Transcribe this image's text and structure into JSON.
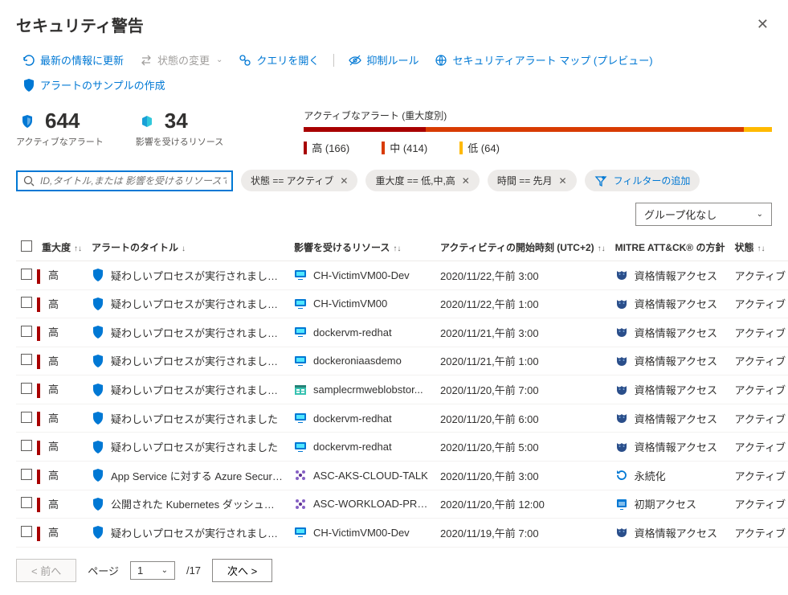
{
  "title": "セキュリティ警告",
  "toolbar": {
    "refresh": "最新の情報に更新",
    "change_state": "状態の変更",
    "open_query": "クエリを開く",
    "suppression": "抑制ルール",
    "alert_map": "セキュリティアラート マップ (プレビュー)",
    "create_sample": "アラートのサンプルの作成"
  },
  "stats": {
    "active_count": "644",
    "active_label": "アクティブなアラート",
    "resources_count": "34",
    "resources_label": "影響を受けるリソース"
  },
  "severity": {
    "title": "アクティブなアラート (重大度別)",
    "high": "高 (166)",
    "medium": "中 (414)",
    "low": "低 (64)"
  },
  "search_placeholder": "ID,タイトル,または 影響を受けるリソースで検索",
  "filters": {
    "state": "状態 == アクティブ",
    "severity": "重大度 == 低,中,高",
    "time": "時間 == 先月",
    "add": "フィルターの追加"
  },
  "group_by": "グループ化なし",
  "columns": {
    "severity": "重大度",
    "title": "アラートのタイトル",
    "resource": "影響を受けるリソース",
    "time": "アクティビティの開始時刻 (UTC+2)",
    "mitre": "MITRE ATT&CK® の方針",
    "state": "状態"
  },
  "rows": [
    {
      "sev": "高",
      "title": "疑わしいプロセスが実行されました [複数 ...",
      "res": "CH-VictimVM00-Dev",
      "res_ico": "vm",
      "time": "2020/11/22,午前 3:00",
      "mitre": "資格情報アクセス",
      "mitre_ico": "mask",
      "state": "アクティブ"
    },
    {
      "sev": "高",
      "title": "疑わしいプロセスが実行されました [複数 ...",
      "res": "CH-VictimVM00",
      "res_ico": "vm",
      "time": "2020/11/22,午前 1:00",
      "mitre": "資格情報アクセス",
      "mitre_ico": "mask",
      "state": "アクティブ"
    },
    {
      "sev": "高",
      "title": "疑わしいプロセスが実行されました [複数 ...",
      "res": "dockervm-redhat",
      "res_ico": "vm",
      "time": "2020/11/21,午前 3:00",
      "mitre": "資格情報アクセス",
      "mitre_ico": "mask",
      "state": "アクティブ"
    },
    {
      "sev": "高",
      "title": "疑わしいプロセスが実行されました [複数 ...",
      "res": "dockeroniaasdemo",
      "res_ico": "vm",
      "time": "2020/11/21,午前 1:00",
      "mitre": "資格情報アクセス",
      "mitre_ico": "mask",
      "state": "アクティブ"
    },
    {
      "sev": "高",
      "title": "疑わしいプロセスが実行されました [複数 ...",
      "res": "samplecrmweblobstor...",
      "res_ico": "storage",
      "time": "2020/11/20,午前 7:00",
      "mitre": "資格情報アクセス",
      "mitre_ico": "mask",
      "state": "アクティブ"
    },
    {
      "sev": "高",
      "title": "疑わしいプロセスが実行されました",
      "res": "dockervm-redhat",
      "res_ico": "vm",
      "time": "2020/11/20,午前 6:00",
      "mitre": "資格情報アクセス",
      "mitre_ico": "mask",
      "state": "アクティブ"
    },
    {
      "sev": "高",
      "title": "疑わしいプロセスが実行されました",
      "res": "dockervm-redhat",
      "res_ico": "vm",
      "time": "2020/11/20,午前 5:00",
      "mitre": "資格情報アクセス",
      "mitre_ico": "mask",
      "state": "アクティブ"
    },
    {
      "sev": "高",
      "title": "App Service に対する Azure Security Ce...",
      "res": "ASC-AKS-CLOUD-TALK",
      "res_ico": "cluster",
      "time": "2020/11/20,午前 3:00",
      "mitre": "永続化",
      "mitre_ico": "persist",
      "state": "アクティブ"
    },
    {
      "sev": "高",
      "title": "公開された Kubernetes ダッシュボードが検...",
      "res": "ASC-WORKLOAD-PRO...",
      "res_ico": "cluster",
      "time": "2020/11/20,午前 12:00",
      "mitre": "初期アクセス",
      "mitre_ico": "initial",
      "state": "アクティブ"
    },
    {
      "sev": "高",
      "title": "疑わしいプロセスが実行されました [複数 ...",
      "res": "CH-VictimVM00-Dev",
      "res_ico": "vm",
      "time": "2020/11/19,午前 7:00",
      "mitre": "資格情報アクセス",
      "mitre_ico": "mask",
      "state": "アクティブ"
    }
  ],
  "pager": {
    "prev": "< 前へ",
    "page_label": "ページ",
    "page": "1",
    "total": "/17",
    "next": "次へ >"
  }
}
